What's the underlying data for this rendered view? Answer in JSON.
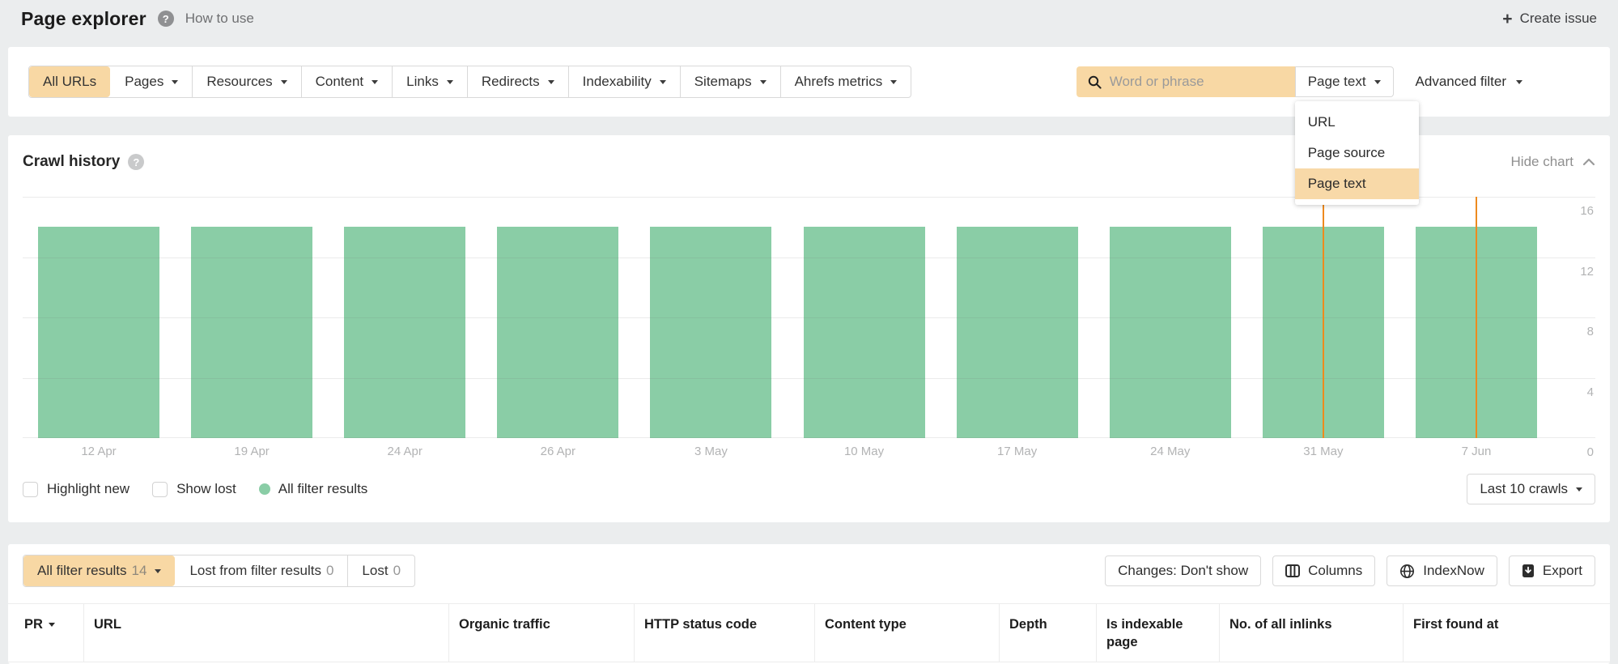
{
  "header": {
    "title": "Page explorer",
    "help_label": "How to use",
    "help_icon": "question-circle-icon",
    "create_issue_label": "Create issue",
    "create_issue_icon": "plus-icon"
  },
  "filter_bar": {
    "tabs": [
      {
        "label": "All URLs",
        "active": true,
        "caret": false
      },
      {
        "label": "Pages",
        "active": false,
        "caret": true
      },
      {
        "label": "Resources",
        "active": false,
        "caret": true
      },
      {
        "label": "Content",
        "active": false,
        "caret": true
      },
      {
        "label": "Links",
        "active": false,
        "caret": true
      },
      {
        "label": "Redirects",
        "active": false,
        "caret": true
      },
      {
        "label": "Indexability",
        "active": false,
        "caret": true
      },
      {
        "label": "Sitemaps",
        "active": false,
        "caret": true
      },
      {
        "label": "Ahrefs metrics",
        "active": false,
        "caret": true
      }
    ],
    "search": {
      "placeholder": "Word or phrase",
      "icon": "search-icon"
    },
    "scope_button": {
      "label": "Page text"
    },
    "advanced_filter_label": "Advanced filter",
    "scope_dropdown": {
      "items": [
        {
          "label": "URL",
          "selected": false
        },
        {
          "label": "Page source",
          "selected": false
        },
        {
          "label": "Page text",
          "selected": true
        }
      ]
    }
  },
  "chart_section": {
    "title": "Crawl history",
    "help_icon": "question-circle-icon",
    "hide_chart_label": "Hide chart",
    "hide_chart_icon": "chevron-up-icon",
    "checkboxes": [
      {
        "label": "Highlight new",
        "checked": false
      },
      {
        "label": "Show lost",
        "checked": false
      }
    ],
    "legend_label": "All filter results",
    "range_button_label": "Last 10 crawls"
  },
  "chart_data": {
    "type": "bar",
    "title": "Crawl history",
    "categories": [
      "12 Apr",
      "19 Apr",
      "24 Apr",
      "26 Apr",
      "3 May",
      "10 May",
      "17 May",
      "24 May",
      "31 May",
      "7 Jun"
    ],
    "series": [
      {
        "name": "All filter results",
        "values": [
          14,
          14,
          14,
          14,
          14,
          14,
          14,
          14,
          14,
          14
        ]
      }
    ],
    "ylim": [
      0,
      16
    ],
    "yticks": [
      0,
      4,
      8,
      12,
      16
    ],
    "y_axis_side": "right",
    "grid": true,
    "legend_position": "bottom-left",
    "bar_color": "#8acda6",
    "marker_color": "#ee8a1e",
    "marked_categories": [
      "31 May",
      "7 Jun"
    ]
  },
  "results_section": {
    "tabs": [
      {
        "label": "All filter results",
        "count": "14",
        "active": true,
        "caret": true
      },
      {
        "label": "Lost from filter results",
        "count": "0",
        "active": false,
        "caret": false
      },
      {
        "label": "Lost",
        "count": "0",
        "active": false,
        "caret": false
      }
    ],
    "buttons": [
      {
        "label": "Changes: Don't show",
        "icon": null
      },
      {
        "label": "Columns",
        "icon": "columns-icon"
      },
      {
        "label": "IndexNow",
        "icon": "globe-icon"
      },
      {
        "label": "Export",
        "icon": "export-icon"
      }
    ],
    "columns": [
      {
        "label": "PR",
        "sorted": true
      },
      {
        "label": "URL",
        "sorted": false
      },
      {
        "label": "Organic traffic",
        "sorted": false
      },
      {
        "label": "HTTP status code",
        "sorted": false
      },
      {
        "label": "Content type",
        "sorted": false
      },
      {
        "label": "Depth",
        "sorted": false
      },
      {
        "label": "Is indexable page",
        "sorted": false
      },
      {
        "label": "No. of all inlinks",
        "sorted": false
      },
      {
        "label": "First found at",
        "sorted": false
      }
    ]
  },
  "colors": {
    "accent_orange_fill": "#f8d8a4",
    "marker_orange": "#ee8a1e",
    "bar_green": "#8acda6",
    "page_background": "#ebedee"
  }
}
